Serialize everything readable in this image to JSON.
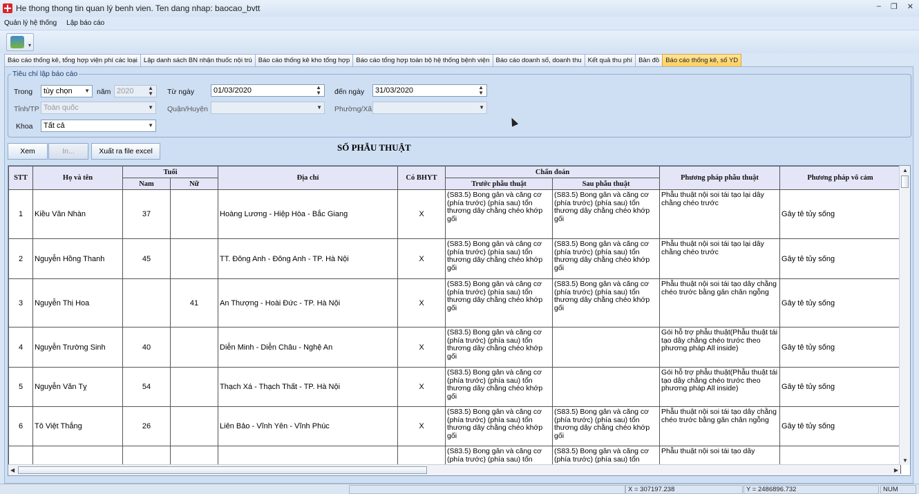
{
  "window": {
    "title": "He thong thong tin quan lý benh vien. Ten dang nhap: baocao_bvtt"
  },
  "menu": [
    "Quản lý hệ thống",
    "Lập báo cáo"
  ],
  "tabs": [
    {
      "label": "Báo cáo thống kê, tổng hợp viện phí các loại",
      "active": false
    },
    {
      "label": "Lập danh sách BN nhận thuốc nội trú",
      "active": false
    },
    {
      "label": "Báo cáo thống kê kho tổng hợp",
      "active": false
    },
    {
      "label": "Báo cáo tổng hợp toàn bộ hệ thống bệnh viện",
      "active": false
    },
    {
      "label": "Báo cáo doanh số, doanh thu",
      "active": false
    },
    {
      "label": "Kết quả thu phí",
      "active": false
    },
    {
      "label": "Bản đồ",
      "active": false
    },
    {
      "label": "Báo cáo thống kê, số YD",
      "active": true
    }
  ],
  "filters": {
    "legend": "Tiêu chí lập báo cáo",
    "trong_label": "Trong",
    "trong_value": "tùy chọn",
    "nam_label": "năm",
    "nam_value": "2020",
    "tungay_label": "Từ ngày",
    "tungay_value": "01/03/2020",
    "denngay_label": "đến ngày",
    "denngay_value": "31/03/2020",
    "tinh_label": "Tỉnh/TP",
    "tinh_value": "Toàn quốc",
    "quan_label": "Quận/Huyện",
    "quan_value": "",
    "phuong_label": "Phường/Xã",
    "phuong_value": "",
    "khoa_label": "Khoa",
    "khoa_value": "Tất cả"
  },
  "buttons": {
    "xem": "Xem",
    "in": "In...",
    "export": "Xuất ra file excel"
  },
  "report_title": "SỐ PHẪU THUẬT",
  "headers": {
    "stt": "STT",
    "hoten": "Họ và tên",
    "tuoi": "Tuổi",
    "nam": "Nam",
    "nu": "Nữ",
    "diachi": "Địa chỉ",
    "bhyt": "Có BHYT",
    "chandoan": "Chẩn đoán",
    "truoc": "Trước phẫu thuật",
    "sau": "Sau phẫu thuật",
    "pppt": "Phương pháp phẫu thuật",
    "ppvc": "Phương pháp vô cảm"
  },
  "rows": [
    {
      "stt": "1",
      "name": "Kiều Văn Nhàn",
      "nam": "37",
      "nu": "",
      "address": "Hoàng Lương - Hiệp Hòa - Bắc Giang",
      "bhyt": "X",
      "before": "(S83.5) Bong gân và căng cơ (phía trước) (phía sau) tổn thương dây chằng chéo khớp gối",
      "after": "(S83.5) Bong gân và căng cơ (phía trước) (phía sau) tổn thương dây chằng chéo khớp gối",
      "method": "Phẫu thuật nội soi tái tạo lại dây chằng chéo trước",
      "anesthesia": "Gây tê tủy sống"
    },
    {
      "stt": "2",
      "name": "Nguyễn Hồng Thanh",
      "nam": "45",
      "nu": "",
      "address": "TT. Đông Anh - Đông Anh - TP. Hà Nội",
      "bhyt": "X",
      "before": "(S83.5) Bong gân và căng cơ (phía trước) (phía sau) tổn thương dây chằng chéo khớp gối",
      "after": "(S83.5) Bong gân và căng cơ (phía trước) (phía sau) tổn thương dây chằng chéo khớp gối",
      "method": "Phẫu thuật nội soi tái tạo lại dây chằng chéo trước",
      "anesthesia": "Gây tê tủy sống"
    },
    {
      "stt": "3",
      "name": "Nguyễn Thị Hoa",
      "nam": "",
      "nu": "41",
      "address": "An Thượng - Hoài Đức - TP. Hà Nội",
      "bhyt": "X",
      "before": "(S83.5) Bong gân và căng cơ (phía trước) (phía sau) tổn thương dây chằng chéo khớp gối",
      "after": "(S83.5) Bong gân và căng cơ (phía trước) (phía sau) tổn thương dây chằng chéo khớp gối",
      "method": "Phẫu thuật nội soi tái tạo dây chằng chéo trước bằng gân chân ngỗng",
      "anesthesia": "Gây tê tủy sống"
    },
    {
      "stt": "4",
      "name": "Nguyễn Trường Sinh",
      "nam": "40",
      "nu": "",
      "address": "Diễn Minh - Diễn Châu - Nghệ An",
      "bhyt": "X",
      "before": "(S83.5) Bong gân và căng cơ (phía trước) (phía sau) tổn thương dây chằng chéo khớp gối",
      "after": "",
      "method": "Gói hỗ trợ phẫu thuật(Phẫu thuật tái tạo dây chằng chéo trước theo phương pháp All inside)",
      "anesthesia": "Gây tê tủy sống"
    },
    {
      "stt": "5",
      "name": "Nguyễn Văn Tỵ",
      "nam": "54",
      "nu": "",
      "address": "Thạch Xá - Thạch Thất - TP. Hà Nội",
      "bhyt": "X",
      "before": "(S83.5) Bong gân và căng cơ (phía trước) (phía sau) tổn thương dây chằng chéo khớp gối",
      "after": "",
      "method": "Gói hỗ trợ phẫu thuật(Phẫu thuật tái tạo dây chằng chéo trước theo phương pháp All inside)",
      "anesthesia": "Gây tê tủy sống"
    },
    {
      "stt": "6",
      "name": "Tô Việt Thắng",
      "nam": "26",
      "nu": "",
      "address": "Liên Bảo - Vĩnh Yên - Vĩnh Phúc",
      "bhyt": "X",
      "before": "(S83.5) Bong gân và căng cơ (phía trước) (phía sau) tổn thương dây chằng chéo khớp gối",
      "after": "(S83.5) Bong gân và căng cơ (phía trước) (phía sau) tổn thương dây chằng chéo khớp gối",
      "method": "Phẫu thuật nội soi tái tạo dây chằng chéo trước bằng gân chân ngỗng",
      "anesthesia": "Gây tê tủy sống"
    },
    {
      "stt": "",
      "name": "",
      "nam": "",
      "nu": "",
      "address": "",
      "bhyt": "",
      "before": "(S83.5) Bong gân và căng cơ (phía trước) (phía sau) tổn",
      "after": "(S83.5) Bong gân và căng cơ (phía trước) (phía sau) tổn",
      "method": "Phẫu thuật nội soi tái tạo dây",
      "anesthesia": ""
    }
  ],
  "status": {
    "x": "X = 307197.238",
    "y": "Y = 2486896.732",
    "num": "NUM"
  }
}
